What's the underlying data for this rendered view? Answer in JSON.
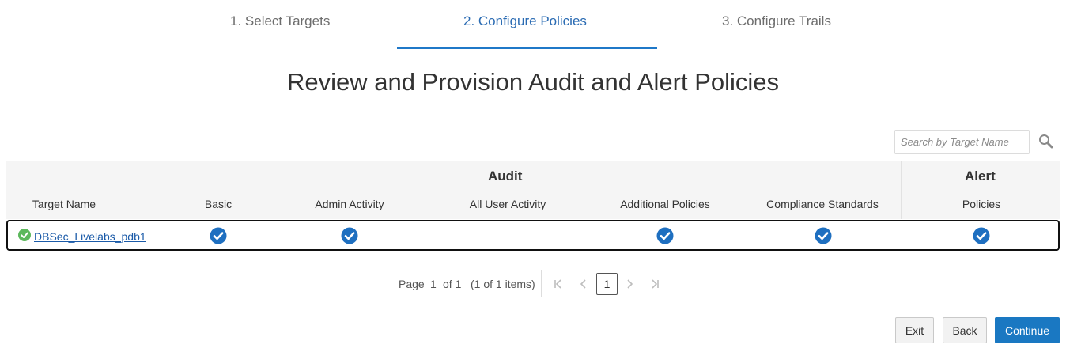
{
  "steps": [
    {
      "label": "1. Select Targets",
      "active": false
    },
    {
      "label": "2. Configure Policies",
      "active": true
    },
    {
      "label": "3. Configure Trails",
      "active": false
    }
  ],
  "page_title": "Review and Provision Audit and Alert Policies",
  "search": {
    "placeholder": "Search by Target Name",
    "value": ""
  },
  "table": {
    "groups": {
      "audit": "Audit",
      "alert": "Alert"
    },
    "columns": {
      "target_name": "Target Name",
      "basic": "Basic",
      "admin_activity": "Admin Activity",
      "all_user_activity": "All User Activity",
      "additional_policies": "Additional Policies",
      "compliance_standards": "Compliance Standards",
      "policies": "Policies"
    },
    "rows": [
      {
        "target_name": "DBSec_Livelabs_pdb1",
        "status": "success",
        "basic": true,
        "admin_activity": true,
        "all_user_activity": false,
        "additional_policies": true,
        "compliance_standards": true,
        "alert_policies": true
      }
    ]
  },
  "pagination": {
    "page_label": "Page",
    "page": "1",
    "of_label": "of 1",
    "items_label": "(1 of 1 items)",
    "current_page": "1"
  },
  "buttons": {
    "exit": "Exit",
    "back": "Back",
    "continue": "Continue"
  },
  "colors": {
    "accent": "#1f78c8",
    "check": "#1e6fc0",
    "success": "#5cb85c",
    "primary_button": "#1a78c2"
  },
  "icons": {
    "search": "magnifier-icon",
    "status": "check-circle-icon",
    "check": "check-circle-icon"
  }
}
